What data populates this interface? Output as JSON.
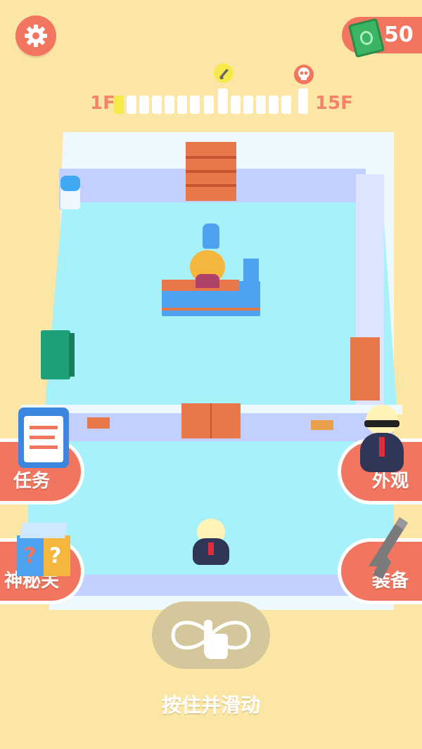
{
  "money": {
    "value": "50",
    "icon": "cash-icon"
  },
  "floors": {
    "start_label": "1F",
    "end_label": "15F",
    "total": 15,
    "current": 1
  },
  "buttons": {
    "tasks": "任务",
    "mystery": "神秘关",
    "appearance": "外观",
    "equipment": "装备"
  },
  "hint": {
    "text": "按住并滑动"
  },
  "colors": {
    "accent": "#f2765f",
    "background": "#fce6a6",
    "floor": "#a7f1fb",
    "money_green": "#3bb563"
  }
}
